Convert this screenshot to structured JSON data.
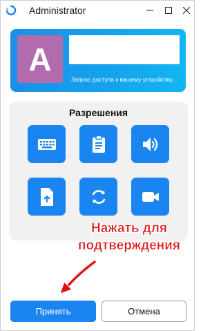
{
  "window": {
    "title": "Administrator"
  },
  "header": {
    "avatar_letter": "A",
    "subtitle": "Запрос доступа к вашему устройству..."
  },
  "permissions": {
    "title": "Разрешения",
    "items": [
      {
        "icon": "keyboard-icon"
      },
      {
        "icon": "clipboard-icon"
      },
      {
        "icon": "speaker-icon"
      },
      {
        "icon": "file-upload-icon"
      },
      {
        "icon": "restart-icon"
      },
      {
        "icon": "video-camera-icon"
      }
    ]
  },
  "annotation": {
    "line1": "Нажать для",
    "line2": "подтверждения"
  },
  "buttons": {
    "accept": "Принять",
    "cancel": "Отмена"
  },
  "colors": {
    "accent": "#1a85f0",
    "avatar": "#b26cae",
    "annotation": "#e01010"
  }
}
